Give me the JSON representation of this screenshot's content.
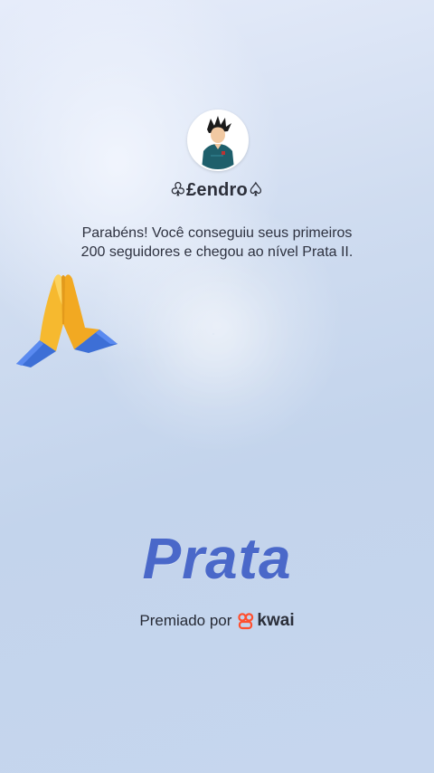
{
  "profile": {
    "username": "♧£endro♤"
  },
  "message": {
    "line1": "Parabéns! Você conseguiu seus primeiros",
    "line2": "200 seguidores e chegou ao nível Prata II."
  },
  "level": {
    "name": "Prata"
  },
  "footer": {
    "awarded_by": "Premiado por",
    "brand": "kwai"
  },
  "icons": {
    "avatar": "avatar-icon",
    "pray": "praying-hands-icon",
    "brand_logo": "kwai-logo-icon"
  },
  "colors": {
    "level_text": "#4a68c9",
    "brand_logo": "#ff4f2e",
    "text": "#2e3240"
  }
}
